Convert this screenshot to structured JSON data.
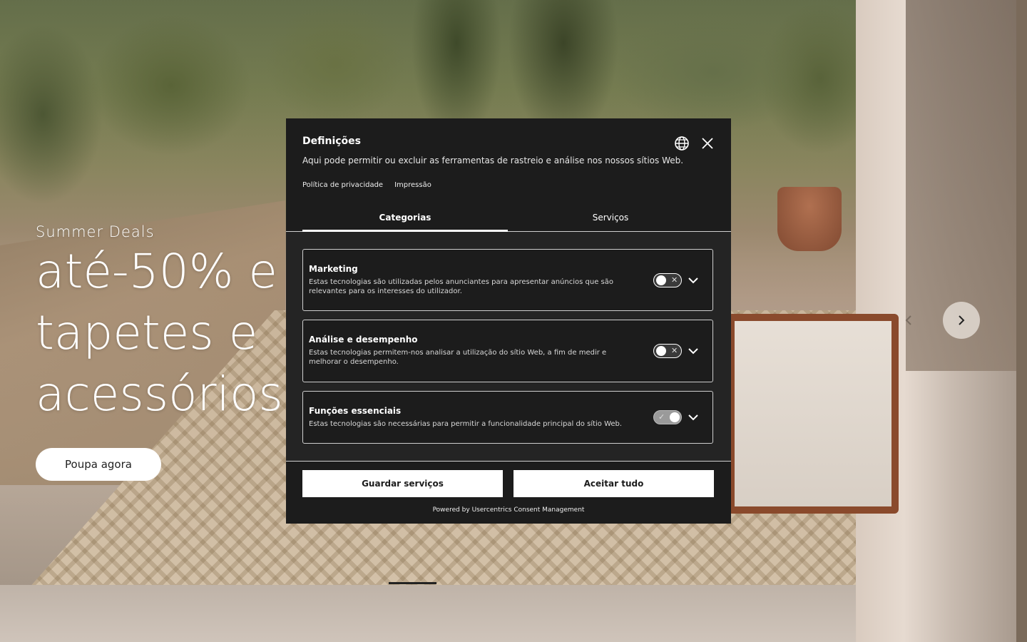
{
  "hero": {
    "eyebrow": "Summer Deals",
    "headline_lines": [
      "até-50% e",
      "tapetes e",
      "acessórios"
    ],
    "cta_label": "Poupa agora"
  },
  "consent": {
    "title": "Definições",
    "description": "Aqui pode permitir ou excluir as ferramentas de rastreio e análise nos nossos sítios Web.",
    "links": {
      "privacy": "Política de privacidade",
      "imprint": "Impressão"
    },
    "tabs": [
      {
        "label": "Categorias",
        "active": true
      },
      {
        "label": "Serviços",
        "active": false
      }
    ],
    "categories": [
      {
        "title": "Marketing",
        "description": "Estas tecnologias são utilizadas pelos anunciantes para apresentar anúncios que são relevantes para os interesses do utilizador.",
        "enabled": false
      },
      {
        "title": "Análise e desempenho",
        "description": "Estas tecnologias permitem-nos analisar a utilização do sítio Web, a fim de medir e melhorar o desempenho.",
        "enabled": false
      },
      {
        "title": "Funções essenciais",
        "description": "Estas tecnologias são necessárias para permitir a funcionalidade principal do sítio Web.",
        "enabled": true
      }
    ],
    "buttons": {
      "save": "Guardar serviços",
      "accept": "Aceitar tudo"
    },
    "powered_by": "Powered by Usercentrics Consent Management",
    "icons": {
      "language": "globe-icon",
      "close": "close-icon",
      "expand": "chevron-down-icon"
    }
  },
  "carousel": {
    "icons": {
      "next": "chevron-right-icon",
      "prev": "chevron-left-icon"
    }
  },
  "colors": {
    "modal_bg": "#1c1c1c",
    "button_bg": "#ffffff",
    "button_text": "#1c1c1c"
  }
}
